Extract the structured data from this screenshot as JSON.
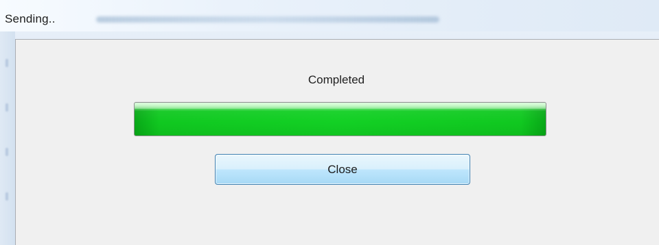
{
  "window": {
    "title": "Sending.."
  },
  "dialog": {
    "status_text": "Completed",
    "progress_percent": 100,
    "close_label": "Close"
  },
  "colors": {
    "progress_green": "#12d024",
    "button_border": "#3c7fb1",
    "dialog_background": "#f0f0f0"
  }
}
